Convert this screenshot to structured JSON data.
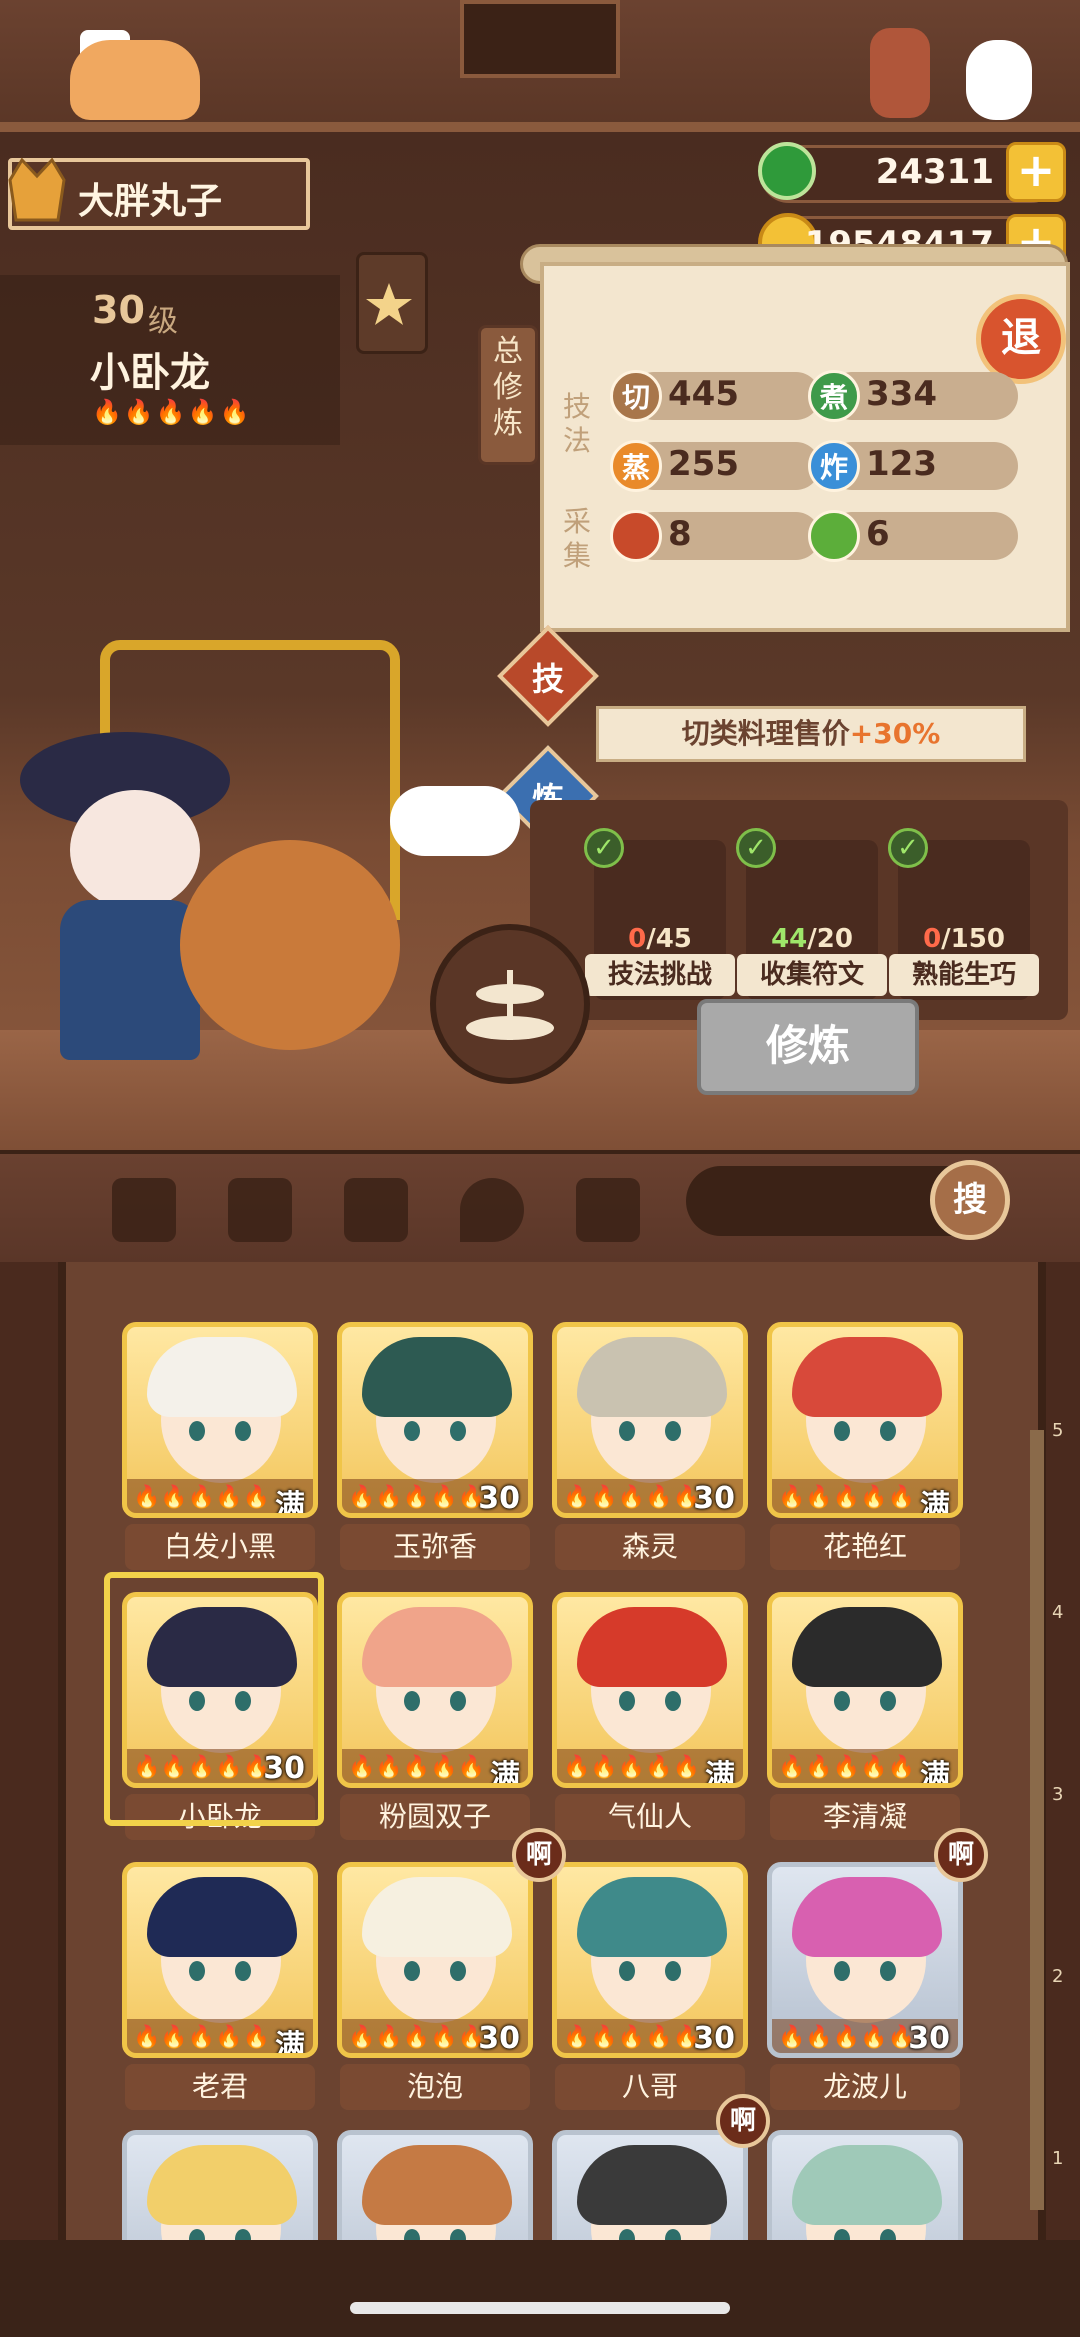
{
  "player": {
    "name": "大胖丸子"
  },
  "chef": {
    "level": "30",
    "level_unit": "级",
    "name": "小卧龙",
    "flames": "🔥🔥🔥🔥🔥"
  },
  "currency": {
    "jade": "24311",
    "coins": "19548417",
    "plus": "+"
  },
  "panel": {
    "side_tab": "总修炼",
    "group_skill": "技法",
    "group_gather": "采集",
    "stats": [
      {
        "icon": "切",
        "value": "445",
        "color": "#a8764a"
      },
      {
        "icon": "煮",
        "value": "334",
        "color": "#3f9a4a"
      },
      {
        "icon": "蒸",
        "value": "255",
        "color": "#e98a2a"
      },
      {
        "icon": "炸",
        "value": "123",
        "color": "#3a8fd8"
      },
      {
        "icon": "",
        "value": "8",
        "color": "#c84a2a"
      },
      {
        "icon": "",
        "value": "6",
        "color": "#5cae3a"
      }
    ],
    "quit": "退"
  },
  "tabs": {
    "skill": "技",
    "train": "炼"
  },
  "bonus": {
    "text": "切类料理售价",
    "pct": "+30%"
  },
  "tasks": [
    {
      "current": "0",
      "total": "/45",
      "label": "技法挑战"
    },
    {
      "current": "44",
      "total": "/20",
      "label": "收集符文"
    },
    {
      "current": "0",
      "total": "/150",
      "label": "熟能生巧"
    }
  ],
  "train_button": "修炼",
  "search_button": "搜",
  "cards": [
    {
      "name": "白发小黑",
      "stat": "满",
      "hair": "#f4f1ea",
      "frame": "gold"
    },
    {
      "name": "玉弥香",
      "stat": "30",
      "hair": "#2d5a52",
      "frame": "gold"
    },
    {
      "name": "森灵",
      "stat": "30",
      "hair": "#c9c2b0",
      "frame": "gold"
    },
    {
      "name": "花艳红",
      "stat": "满",
      "hair": "#d8493a",
      "frame": "gold"
    },
    {
      "name": "小卧龙",
      "stat": "30",
      "hair": "#2a2a45",
      "frame": "gold"
    },
    {
      "name": "粉圆双子",
      "stat": "满",
      "hair": "#f0a48a",
      "frame": "gold"
    },
    {
      "name": "气仙人",
      "stat": "满",
      "hair": "#d63a2a",
      "frame": "gold"
    },
    {
      "name": "李清凝",
      "stat": "满",
      "hair": "#2b2b2b",
      "frame": "gold"
    },
    {
      "name": "老君",
      "stat": "满",
      "hair": "#1f2a55",
      "frame": "gold"
    },
    {
      "name": "泡泡",
      "stat": "30",
      "hair": "#f6f0e0",
      "frame": "gold"
    },
    {
      "name": "八哥",
      "stat": "30",
      "hair": "#3f8a8a",
      "frame": "gold"
    },
    {
      "name": "龙波儿",
      "stat": "30",
      "hair": "#d860b0",
      "frame": "silver"
    },
    {
      "name": "",
      "stat": "",
      "hair": "#f2cf6a",
      "frame": "silver"
    },
    {
      "name": "",
      "stat": "",
      "hair": "#c57a44",
      "frame": "silver"
    },
    {
      "name": "",
      "stat": "",
      "hair": "#3a3a3a",
      "frame": "silver"
    },
    {
      "name": "",
      "stat": "",
      "hair": "#9fc9b8",
      "frame": "silver"
    }
  ],
  "card_flames": "🔥🔥🔥🔥🔥",
  "badge": "啊",
  "ruler_ticks": [
    "5",
    "4",
    "3",
    "2",
    "1"
  ]
}
